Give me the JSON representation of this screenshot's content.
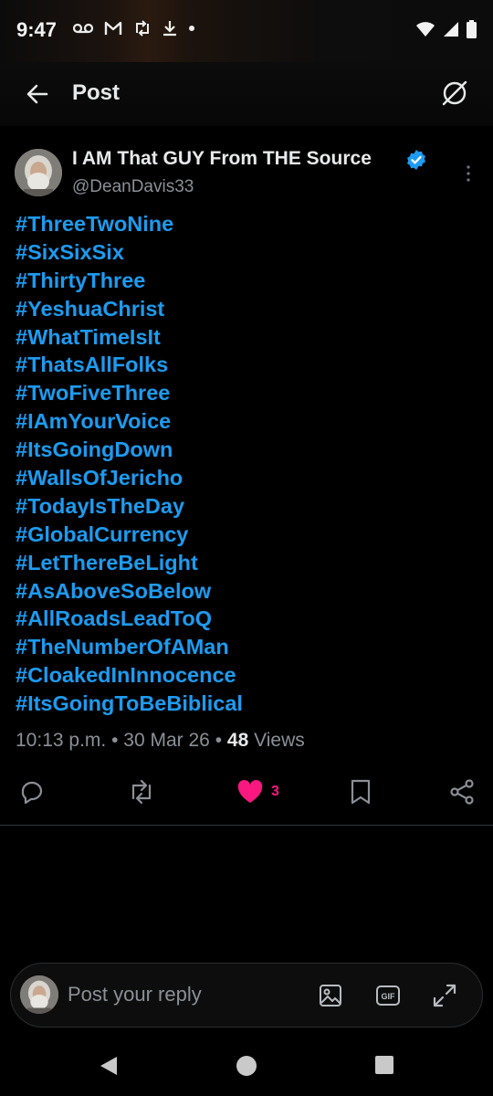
{
  "status_bar": {
    "time": "9:47",
    "left_icons": [
      "voicemail-icon",
      "gmail-icon",
      "retweet-sync-icon",
      "download-icon",
      "dot-icon"
    ],
    "right_icons": [
      "wifi-icon",
      "signal-icon",
      "battery-icon"
    ]
  },
  "header": {
    "title": "Post",
    "back_icon": "arrow-left-icon",
    "right_icon": "grok-icon"
  },
  "post": {
    "author_name": "I AM That GUY From THE Source",
    "author_handle": "@DeanDavis33",
    "verified": true,
    "hashtags": [
      "#ThreeTwoNine",
      "#SixSixSix",
      "#ThirtyThree",
      "#YeshuaChrist",
      "#WhatTimeIsIt",
      "#ThatsAllFolks",
      "#TwoFiveThree",
      "#IAmYourVoice",
      "#ItsGoingDown",
      "#WallsOfJericho",
      "#TodayIsTheDay",
      "#GlobalCurrency",
      "#LetThereBeLight",
      "#AsAboveSoBelow",
      "#AllRoadsLeadToQ",
      "#TheNumberOfAMan",
      "#CloakedInInnocence",
      "#ItsGoingToBeBiblical"
    ],
    "time": "10:13 p.m.",
    "separator": "•",
    "date": "30 Mar 26",
    "views_count": "48",
    "views_label": "Views",
    "likes_count": "3"
  },
  "reply": {
    "placeholder": "Post your reply",
    "icons": [
      "image-icon",
      "gif-icon",
      "expand-icon"
    ]
  },
  "colors": {
    "accent": "#1d9bf0",
    "like": "#f91880",
    "text": "#e7e9ea",
    "muted": "#8b9096",
    "background": "#000000"
  }
}
